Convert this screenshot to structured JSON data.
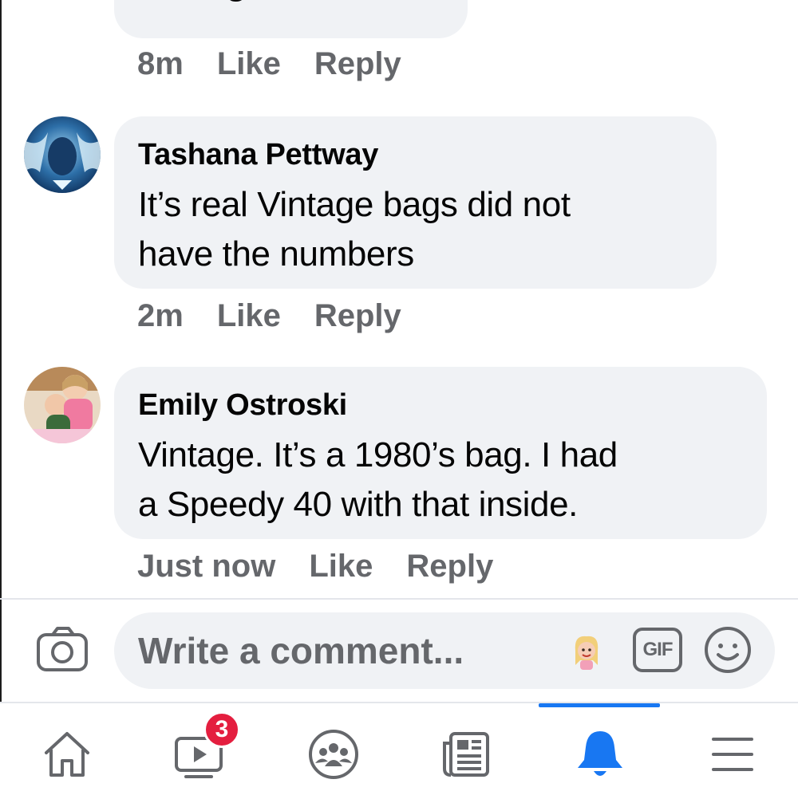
{
  "comments": [
    {
      "text": "Vintage",
      "time": "8m",
      "like": "Like",
      "reply": "Reply"
    },
    {
      "author": "Tashana Pettway",
      "text_line1": "It’s real Vintage bags did not",
      "text_line2": "have the numbers",
      "time": "2m",
      "like": "Like",
      "reply": "Reply"
    },
    {
      "author": "Emily Ostroski",
      "text_line1": "Vintage. It’s a 1980’s bag. I had",
      "text_line2": "a Speedy 40 with that inside.",
      "time": "Just now",
      "like": "Like",
      "reply": "Reply"
    }
  ],
  "composer": {
    "placeholder": "Write a comment...",
    "gif_label": "GIF"
  },
  "tabbar": {
    "tabs": [
      {
        "icon": "home-icon"
      },
      {
        "icon": "watch-video-icon",
        "badge": "3"
      },
      {
        "icon": "groups-icon"
      },
      {
        "icon": "news-feed-icon"
      },
      {
        "icon": "notifications-bell-icon",
        "active": true
      },
      {
        "icon": "menu-icon"
      }
    ]
  },
  "colors": {
    "accent": "#1877f2",
    "bubble": "#f0f2f5",
    "meta": "#65676b",
    "badge": "#e41e3f"
  }
}
